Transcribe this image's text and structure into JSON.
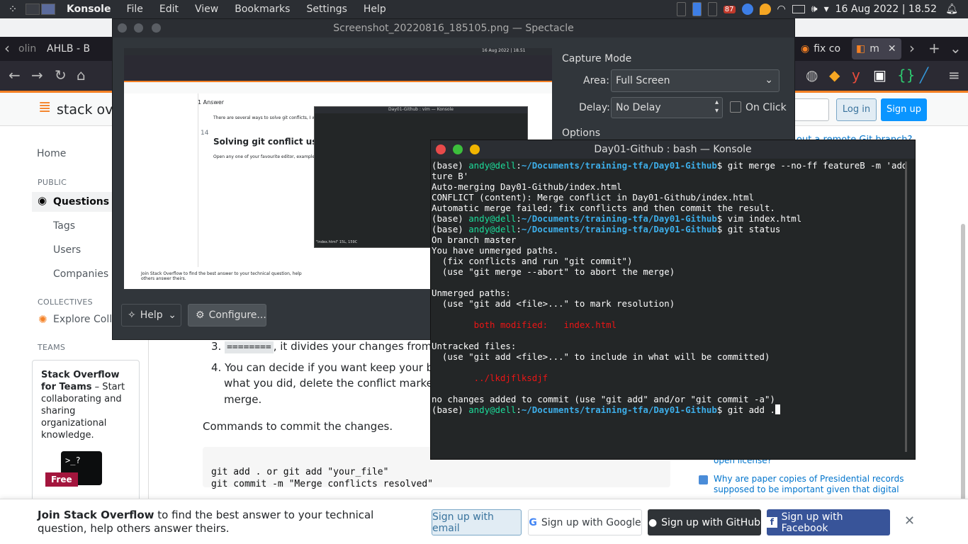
{
  "panel": {
    "app_name": "Konsole",
    "menu": [
      "File",
      "Edit",
      "View",
      "Bookmarks",
      "Settings",
      "Help"
    ],
    "battery_badge": "87",
    "datetime": "16 Aug 2022 | 18.52"
  },
  "firefox": {
    "tabs": [
      "olin",
      "AHLB - B",
      "fix co",
      "m"
    ],
    "search_partial": "",
    "login": "Log in",
    "signup": "Sign up",
    "logo_text": "stack over",
    "sidebar": {
      "home": "Home",
      "public": "PUBLIC",
      "questions": "Questions",
      "tags": "Tags",
      "users": "Users",
      "companies": "Companies",
      "collectives": "COLLECTIVES",
      "explore": "Explore Collec",
      "teams": "TEAMS",
      "teams_title": "Stack Overflow for Teams",
      "teams_desc": " – Start collaborating and sharing organizational knowledge.",
      "free": "Free"
    },
    "answer": {
      "item3_code": "========",
      "item3_text": ", it divides your changes from the",
      "item4_text": "You can decide if you want keep your branc",
      "item4_line2": "what you did, delete the conflict marker they",
      "item4_line3": "merge.",
      "commit_label": "Commands to commit the changes.",
      "code_line1": "git add . or git add \"your_file\"",
      "code_line2": "git commit -m \"Merge conflicts resolved\""
    },
    "right_col": {
      "link_top": "out a remote Git branch?",
      "link_partial": "open license?",
      "link_q": "Why are paper copies of Presidential records supposed to be important given that digital copies"
    }
  },
  "spectacle": {
    "title": "Screenshot_20220816_185105.png — Spectacle",
    "capture_mode": "Capture Mode",
    "area_label": "Area:",
    "area_value": "Full Screen",
    "delay_label": "Delay:",
    "delay_value": "No Delay",
    "on_click": "On Click",
    "options": "Options",
    "help": "Help",
    "configure": "Configure...",
    "preview": {
      "answer_count": "1 Answer",
      "heading": "Solving git conflict using",
      "vote": "14",
      "intro": "There are several ways to solve git conflicts, I w",
      "open_text": "Open any one of your favourite editor, example,",
      "vim_title": "Day01-Github : vim — Konsole",
      "vim_status": "\"index.html\" 15L, 159C",
      "banner": "Join Stack Overflow to find the best answer to your technical question, help others answer theirs.",
      "preview_panel_date": "16 Aug 2022 | 18.51"
    }
  },
  "konsole": {
    "title": "Day01-Github : bash — Konsole",
    "lines": [
      {
        "type": "prompt",
        "cmd": "git merge --no-ff featureB -m 'add fea"
      },
      {
        "type": "text",
        "text": "ture B'"
      },
      {
        "type": "text",
        "text": "Auto-merging Day01-Github/index.html"
      },
      {
        "type": "text",
        "text": "CONFLICT (content): Merge conflict in Day01-Github/index.html"
      },
      {
        "type": "text",
        "text": "Automatic merge failed; fix conflicts and then commit the result."
      },
      {
        "type": "prompt",
        "cmd": "vim index.html"
      },
      {
        "type": "prompt",
        "cmd": "git status"
      },
      {
        "type": "text",
        "text": "On branch master"
      },
      {
        "type": "text",
        "text": "You have unmerged paths."
      },
      {
        "type": "text",
        "text": "  (fix conflicts and run \"git commit\")"
      },
      {
        "type": "text",
        "text": "  (use \"git merge --abort\" to abort the merge)"
      },
      {
        "type": "text",
        "text": ""
      },
      {
        "type": "text",
        "text": "Unmerged paths:"
      },
      {
        "type": "text",
        "text": "  (use \"git add <file>...\" to mark resolution)"
      },
      {
        "type": "text",
        "text": ""
      },
      {
        "type": "red",
        "text": "        both modified:   index.html"
      },
      {
        "type": "text",
        "text": ""
      },
      {
        "type": "text",
        "text": "Untracked files:"
      },
      {
        "type": "text",
        "text": "  (use \"git add <file>...\" to include in what will be committed)"
      },
      {
        "type": "text",
        "text": ""
      },
      {
        "type": "red",
        "text": "        ../lkdjflksdjf"
      },
      {
        "type": "text",
        "text": ""
      },
      {
        "type": "text",
        "text": "no changes added to commit (use \"git add\" and/or \"git commit -a\")"
      },
      {
        "type": "prompt_cursor",
        "cmd": "git add ."
      }
    ],
    "prompt_base": "(base) ",
    "prompt_user": "andy@dell",
    "prompt_path": "~/Documents/training-tfa/Day01-Github",
    "prompt_end": "$ "
  },
  "banner": {
    "title_bold": "Join Stack Overflow",
    "title_rest": " to find the best answer to your technical question, help others answer theirs.",
    "email": "Sign up with email",
    "google": "Sign up with Google",
    "github": "Sign up with GitHub",
    "facebook": "Sign up with Facebook"
  },
  "colors": {
    "accent": "#f48024",
    "so_blue": "#0a95ff",
    "terminal_bg": "#232627"
  }
}
